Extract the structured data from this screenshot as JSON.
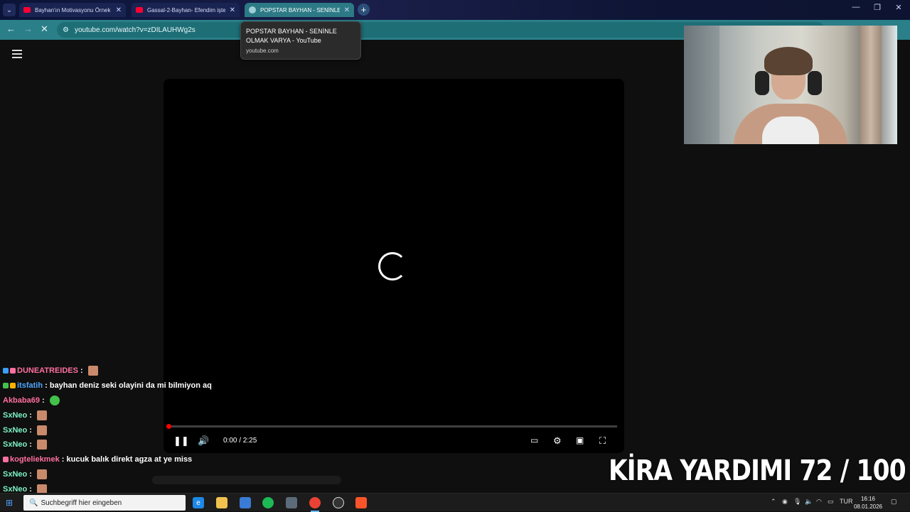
{
  "browser": {
    "tabs": [
      {
        "title": "Bayhan'ın Motivasyonu Örnek",
        "active": false,
        "favicon": "youtube-icon"
      },
      {
        "title": "Gassal-2-Bayhan- Efendim işte",
        "active": false,
        "favicon": "youtube-icon"
      },
      {
        "title": "POPSTAR BAYHAN - SENİNLE O",
        "active": true,
        "favicon": "globe-icon"
      }
    ],
    "new_tab_label": "+",
    "address": "youtube.com/watch?v=zDILAUHWg2s",
    "tooltip": {
      "title": "POPSTAR BAYHAN - SENİNLE OLMAK VARYA - YouTube",
      "domain": "youtube.com"
    },
    "accent_color": "#2a7f88"
  },
  "player": {
    "time": "0:00 / 2:25",
    "progress_fraction": 0.0,
    "state": "loading"
  },
  "chat": [
    {
      "user": "DUNEATREIDES",
      "color": "#ff6fa0",
      "text": "",
      "emote": true,
      "badges": [
        "#3aa0ff",
        "#ff6fa0"
      ]
    },
    {
      "user": "itsfatih",
      "color": "#4fa6ff",
      "text": "bayhan deniz seki olayini da mi bilmiyon aq",
      "emote": false,
      "badges": [
        "#43c14b",
        "#ffb300"
      ]
    },
    {
      "user": "Akbaba69",
      "color": "#ff6fa0",
      "text": "",
      "emote": true,
      "emote_green": true,
      "badges": []
    },
    {
      "user": "SxNeo",
      "color": "#7cf2c5",
      "text": "",
      "emote": true,
      "badges": []
    },
    {
      "user": "SxNeo",
      "color": "#7cf2c5",
      "text": "",
      "emote": true,
      "badges": []
    },
    {
      "user": "SxNeo",
      "color": "#7cf2c5",
      "text": "",
      "emote": true,
      "badges": []
    },
    {
      "user": "kogteliekmek",
      "color": "#ff6fa0",
      "text": "kucuk balık direkt agza at ye miss",
      "emote": false,
      "badges": [
        "#ff6fa0"
      ]
    },
    {
      "user": "SxNeo",
      "color": "#7cf2c5",
      "text": "",
      "emote": true,
      "badges": []
    },
    {
      "user": "SxNeo",
      "color": "#7cf2c5",
      "text": "",
      "emote": true,
      "badges": []
    }
  ],
  "overlay": {
    "banner": "KİRA YARDIMI  72 / 100",
    "goal_current": 72,
    "goal_total": 100
  },
  "taskbar": {
    "search_placeholder": "Suchbegriff hier eingeben",
    "language": "TUR",
    "time": "16:16",
    "date": "08.01.2026"
  }
}
